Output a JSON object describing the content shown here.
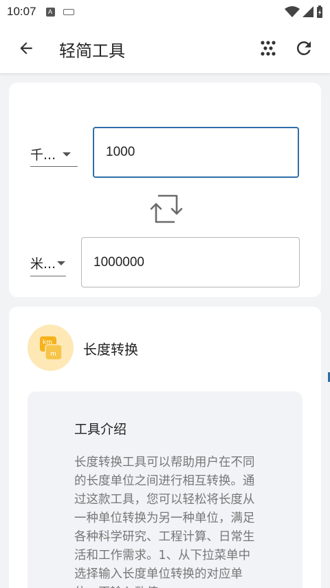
{
  "status_bar": {
    "time": "10:07",
    "notif_icon_letter": "A"
  },
  "app_bar": {
    "title": "轻简工具"
  },
  "converter": {
    "from_unit": "千...",
    "from_value": "1000",
    "to_unit": "米...",
    "to_value": "1000000"
  },
  "tool": {
    "name": "长度转换",
    "icon_label_top": "km",
    "icon_label_bottom": "m"
  },
  "intro": {
    "title": "工具介绍",
    "text": "长度转换工具可以帮助用户在不同的长度单位之间进行相互转换。通过这款工具，您可以轻松将长度从一种单位转换为另一种单位，满足各种科学研究、工程计算、日常生活和工作需求。1、从下拉菜单中选择输入长度单位转换的对应单位，再输入数值"
  },
  "colors": {
    "accent": "#2e6ea7",
    "icon_bg": "#fde8b6",
    "icon_fg": "#f5b21a"
  }
}
